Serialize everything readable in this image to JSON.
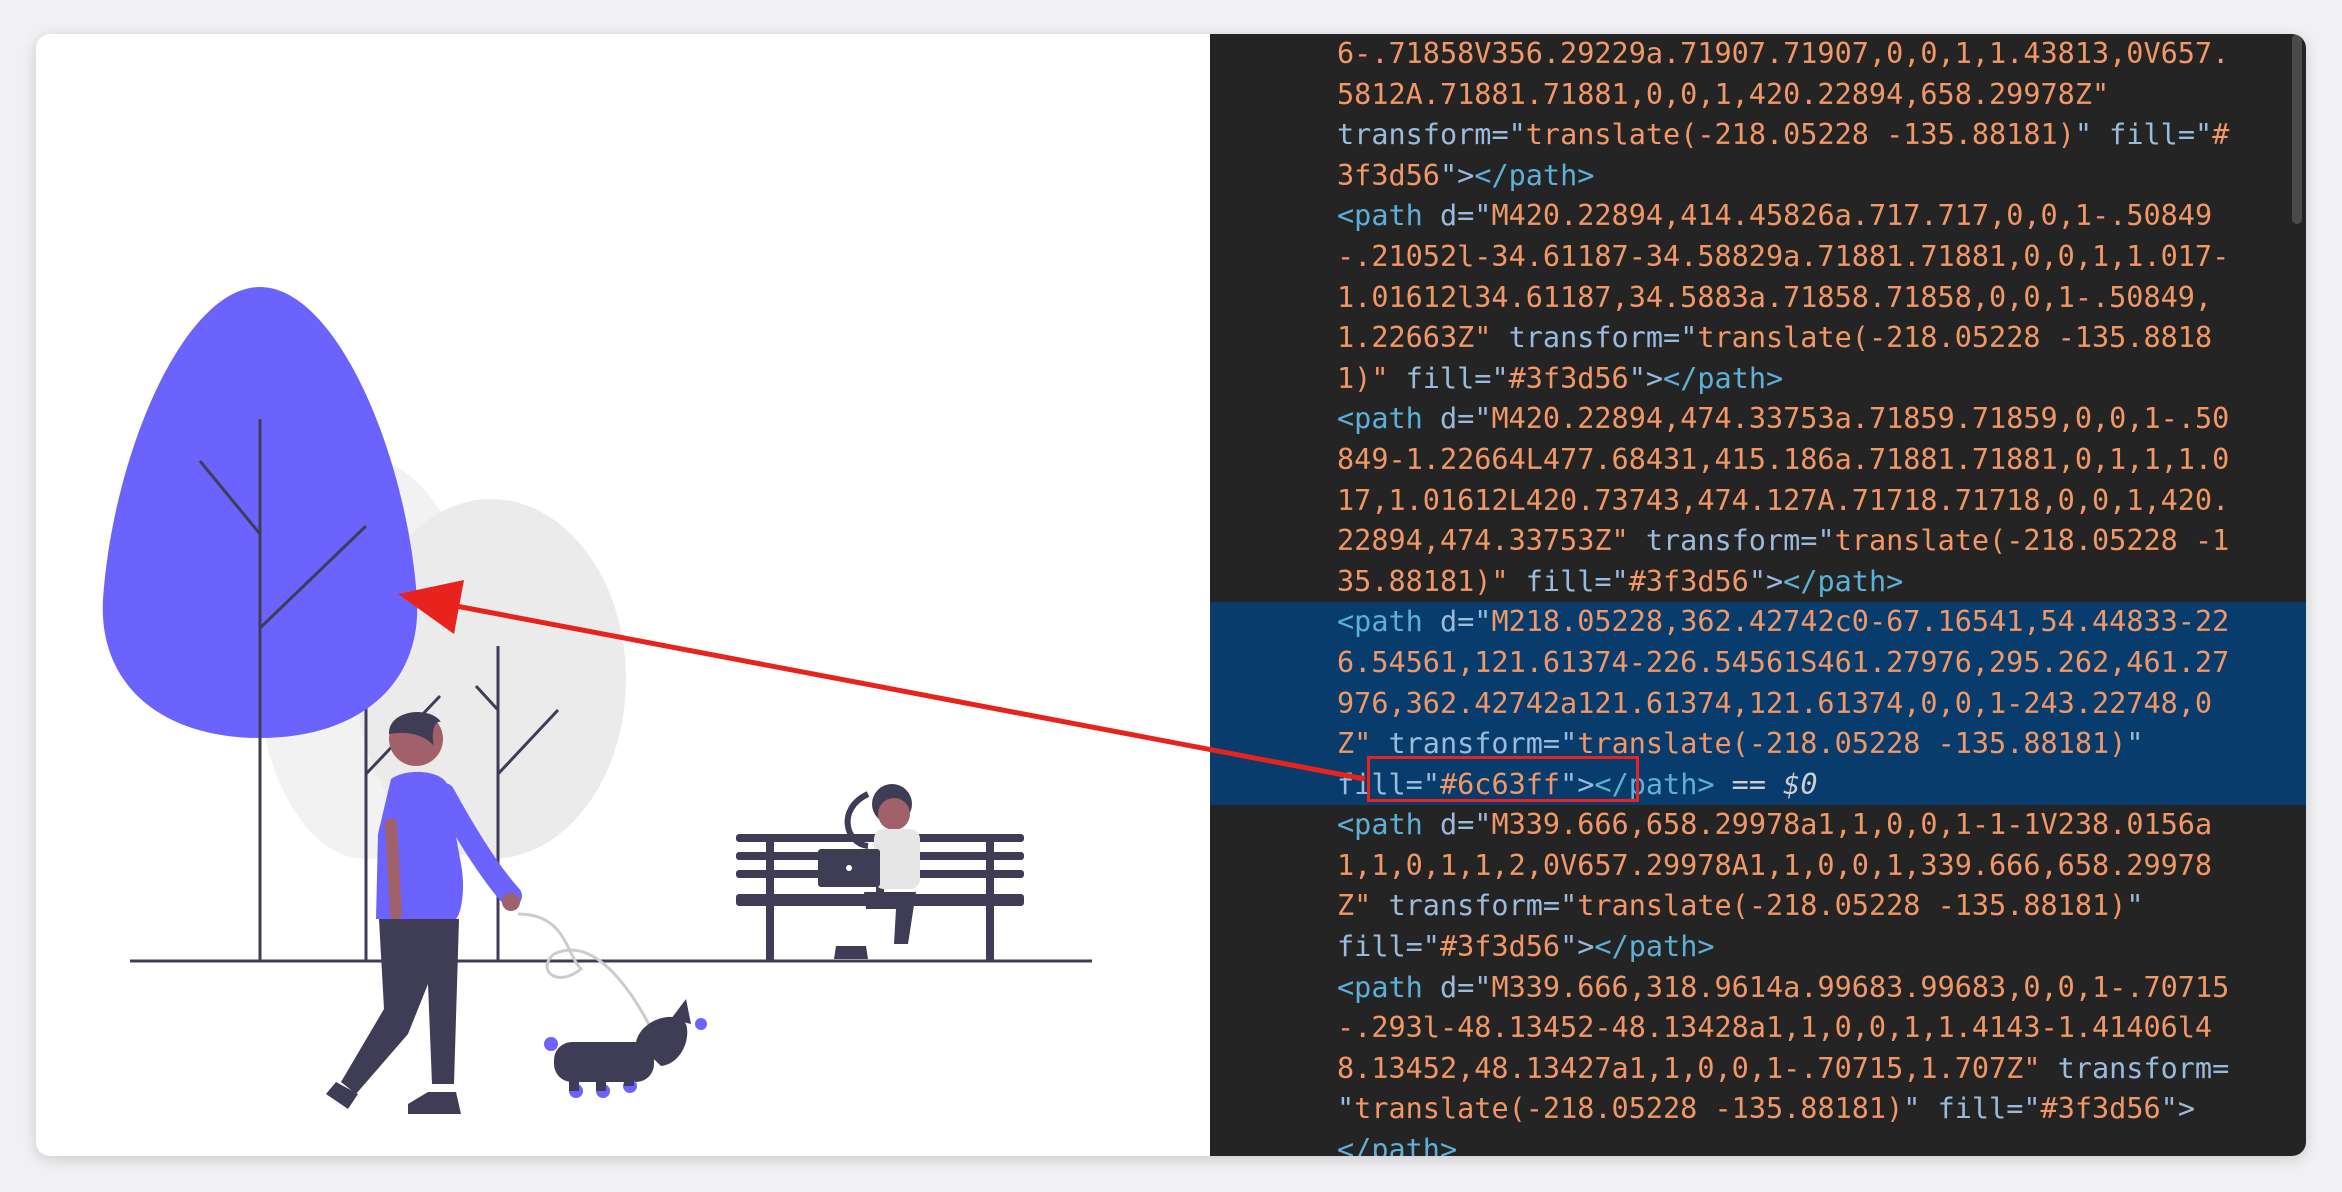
{
  "colors": {
    "accent": "#6c63ff",
    "dark": "#3f3d56",
    "gray": "#f2f2f2",
    "annotation": "#e8231d",
    "devtools_bg": "#242424",
    "selection": "#073c6c"
  },
  "devtools": {
    "selected_marker": "== $0",
    "lines": [
      [
        [
          "val",
          "6-.71858V356.29229a.71907.71907,0,0,1,1.43813,0V657."
        ]
      ],
      [
        [
          "val",
          "5812A.71881.71881,0,0,1,420.22894,658.29978Z\""
        ]
      ],
      [
        [
          "attr",
          "transform"
        ],
        [
          "punct",
          "=\""
        ],
        [
          "val",
          "translate(-218.05228 -135.88181)"
        ],
        [
          "punct",
          "\" "
        ],
        [
          "attr",
          "fill"
        ],
        [
          "punct",
          "=\""
        ],
        [
          "val",
          "#"
        ]
      ],
      [
        [
          "val",
          "3f3d56"
        ],
        [
          "punct",
          "\">"
        ],
        [
          "tag",
          "</path>"
        ]
      ],
      [
        [
          "tag",
          "<path "
        ],
        [
          "attr",
          "d"
        ],
        [
          "punct",
          "=\""
        ],
        [
          "val",
          "M420.22894,414.45826a.717.717,0,0,1-.50849"
        ]
      ],
      [
        [
          "val",
          "-.21052l-34.61187-34.58829a.71881.71881,0,0,1,1.017-"
        ]
      ],
      [
        [
          "val",
          "1.01612l34.61187,34.5883a.71858.71858,0,0,1-.50849,"
        ]
      ],
      [
        [
          "val",
          "1.22663Z\" "
        ],
        [
          "attr",
          "transform"
        ],
        [
          "punct",
          "=\""
        ],
        [
          "val",
          "translate(-218.05228 -135.8818"
        ]
      ],
      [
        [
          "val",
          "1)\" "
        ],
        [
          "attr",
          "fill"
        ],
        [
          "punct",
          "=\""
        ],
        [
          "val",
          "#3f3d56"
        ],
        [
          "punct",
          "\">"
        ],
        [
          "tag",
          "</path>"
        ]
      ],
      [
        [
          "tag",
          "<path "
        ],
        [
          "attr",
          "d"
        ],
        [
          "punct",
          "=\""
        ],
        [
          "val",
          "M420.22894,474.33753a.71859.71859,0,0,1-.50"
        ]
      ],
      [
        [
          "val",
          "849-1.22664L477.68431,415.186a.71881.71881,0,1,1,1.0"
        ]
      ],
      [
        [
          "val",
          "17,1.01612L420.73743,474.127A.71718.71718,0,0,1,420."
        ]
      ],
      [
        [
          "val",
          "22894,474.33753Z\" "
        ],
        [
          "attr",
          "transform"
        ],
        [
          "punct",
          "=\""
        ],
        [
          "val",
          "translate(-218.05228 -1"
        ]
      ],
      [
        [
          "val",
          "35.88181)\" "
        ],
        [
          "attr",
          "fill"
        ],
        [
          "punct",
          "=\""
        ],
        [
          "val",
          "#3f3d56"
        ],
        [
          "punct",
          "\">"
        ],
        [
          "tag",
          "</path>"
        ]
      ],
      [
        [
          "tag",
          "<path "
        ],
        [
          "attr",
          "d"
        ],
        [
          "punct",
          "=\""
        ],
        [
          "val",
          "M218.05228,362.42742c0-67.16541,54.44833-22"
        ]
      ],
      [
        [
          "val",
          "6.54561,121.61374-226.54561S461.27976,295.262,461.27"
        ]
      ],
      [
        [
          "val",
          "976,362.42742a121.61374,121.61374,0,0,1-243.22748,0"
        ]
      ],
      [
        [
          "val",
          "Z\" "
        ],
        [
          "attr",
          "transform"
        ],
        [
          "punct",
          "=\""
        ],
        [
          "val",
          "translate(-218.05228 -135.88181)"
        ],
        [
          "punct",
          "\""
        ]
      ],
      [
        [
          "attr",
          "fill"
        ],
        [
          "punct",
          "=\""
        ],
        [
          "val",
          "#6c63ff"
        ],
        [
          "punct",
          "\">"
        ],
        [
          "tag",
          "</path>"
        ],
        [
          "eq",
          " == "
        ],
        [
          "var",
          "$0"
        ]
      ],
      [
        [
          "tag",
          "<path "
        ],
        [
          "attr",
          "d"
        ],
        [
          "punct",
          "=\""
        ],
        [
          "val",
          "M339.666,658.29978a1,1,0,0,1-1-1V238.0156a"
        ]
      ],
      [
        [
          "val",
          "1,1,0,1,1,2,0V657.29978A1,1,0,0,1,339.666,658.29978"
        ]
      ],
      [
        [
          "val",
          "Z\" "
        ],
        [
          "attr",
          "transform"
        ],
        [
          "punct",
          "=\""
        ],
        [
          "val",
          "translate(-218.05228 -135.88181)"
        ],
        [
          "punct",
          "\""
        ]
      ],
      [
        [
          "attr",
          "fill"
        ],
        [
          "punct",
          "=\""
        ],
        [
          "val",
          "#3f3d56"
        ],
        [
          "punct",
          "\">"
        ],
        [
          "tag",
          "</path>"
        ]
      ],
      [
        [
          "tag",
          "<path "
        ],
        [
          "attr",
          "d"
        ],
        [
          "punct",
          "=\""
        ],
        [
          "val",
          "M339.666,318.9614a.99683.99683,0,0,1-.70715"
        ]
      ],
      [
        [
          "val",
          "-.293l-48.13452-48.13428a1,1,0,0,1,1.4143-1.41406l4"
        ]
      ],
      [
        [
          "val",
          "8.13452,48.13427a1,1,0,0,1-.70715,1.707Z\" "
        ],
        [
          "attr",
          "transform"
        ],
        [
          "punct",
          "="
        ]
      ],
      [
        [
          "punct",
          "\""
        ],
        [
          "val",
          "translate(-218.05228 -135.88181)"
        ],
        [
          "punct",
          "\" "
        ],
        [
          "attr",
          "fill"
        ],
        [
          "punct",
          "=\""
        ],
        [
          "val",
          "#3f3d56"
        ],
        [
          "punct",
          "\">"
        ]
      ],
      [
        [
          "tag",
          "</path>"
        ]
      ]
    ],
    "selected_range": [
      14,
      18
    ]
  }
}
